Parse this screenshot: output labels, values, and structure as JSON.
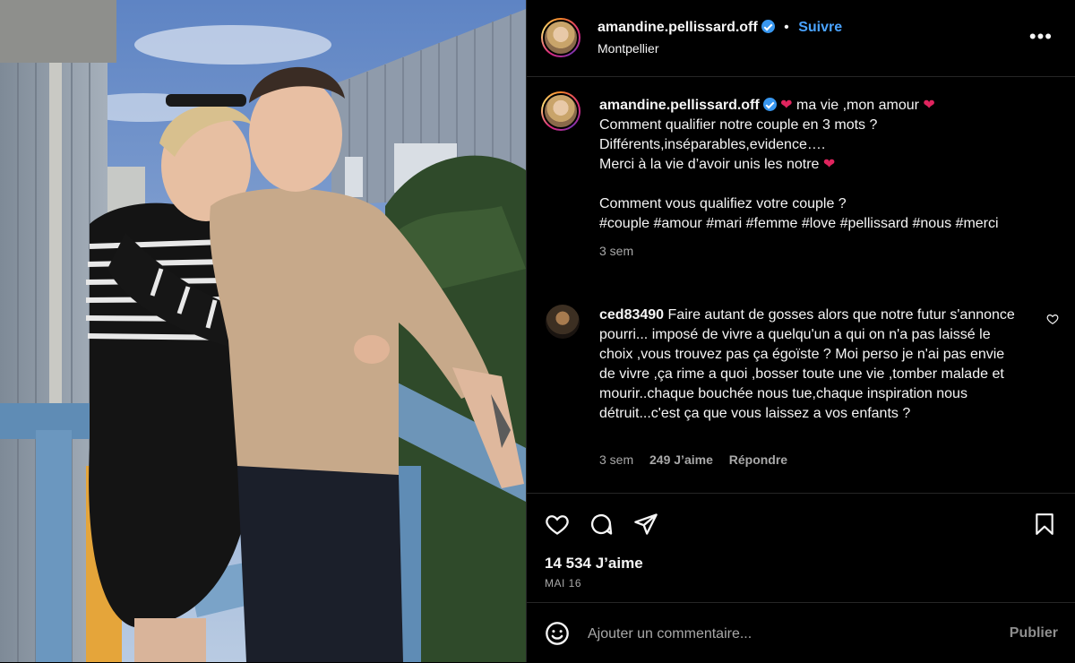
{
  "post": {
    "username": "amandine.pellissard.off",
    "follow_label": "Suivre",
    "location": "Montpellier",
    "more_label": "•••",
    "separator": "•"
  },
  "caption": {
    "username": "amandine.pellissard.off",
    "line1_text": "ma vie ,mon amour",
    "line2": "Comment qualifier notre couple en 3 mots ?",
    "line3": "Différents,inséparables,evidence….",
    "line4": "Merci à la vie d’avoir unis les notre",
    "line5": "Comment vous qualifiez votre couple ?",
    "hashtags": "#couple #amour #mari #femme #love #pellissard #nous #merci",
    "time": "3 sem"
  },
  "comment": {
    "username": "ced83490",
    "text": "Faire autant de gosses alors que notre futur s'annonce pourri... imposé de vivre a quelqu'un a qui on n'a pas laissé le choix ,vous trouvez pas ça égoïste ? Moi perso je n'ai pas envie de vivre ,ça rime a quoi ,bosser toute une vie ,tomber malade et mourir..chaque bouchée nous tue,chaque inspiration nous détruit...c'est ça que vous laissez a vos enfants ?",
    "time": "3 sem",
    "likes": "249 J’aime",
    "reply_label": "Répondre"
  },
  "footer": {
    "likes": "14 534 J’aime",
    "date": "MAI 16",
    "comment_placeholder": "Ajouter un commentaire...",
    "publish_label": "Publier"
  },
  "icons": {
    "like": "heart-icon",
    "comment": "comment-icon",
    "share": "share-icon",
    "save": "bookmark-icon",
    "emoji": "emoji-icon",
    "comment_like": "heart-icon"
  },
  "colors": {
    "background": "#000000",
    "link_blue": "#4aa3ff",
    "verified_blue": "#3897f0",
    "muted_text": "#a8a8a8",
    "heart_red": "#e0245e"
  }
}
